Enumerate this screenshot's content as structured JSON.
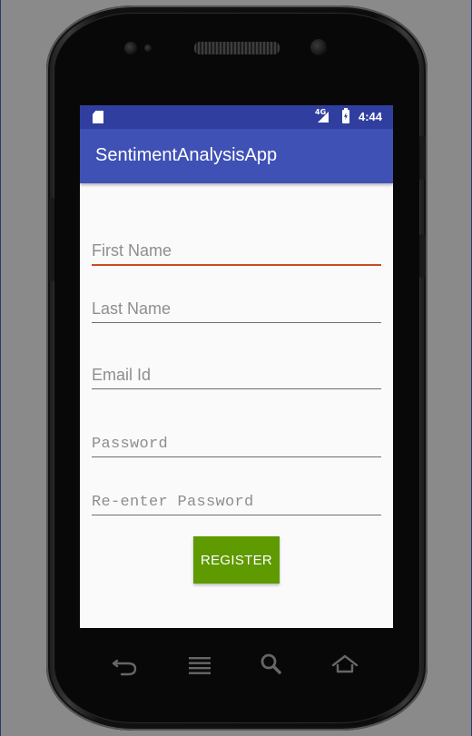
{
  "status_bar": {
    "network": "4G",
    "time": "4:44"
  },
  "app_bar": {
    "title": "SentimentAnalysisApp"
  },
  "form": {
    "first_name": {
      "placeholder": "First Name",
      "focused": true
    },
    "last_name": {
      "placeholder": "Last Name"
    },
    "email": {
      "placeholder": "Email Id"
    },
    "password": {
      "placeholder": "Password"
    },
    "reenter_password": {
      "placeholder": "Re-enter Password"
    },
    "register_button": "REGISTER"
  },
  "nav_buttons": [
    "back-icon",
    "menu-icon",
    "search-icon",
    "home-icon"
  ],
  "colors": {
    "status_bar": "#303f9f",
    "app_bar": "#3f51b5",
    "focus_underline": "#ce4a1e",
    "register_button": "#5e9a00"
  }
}
